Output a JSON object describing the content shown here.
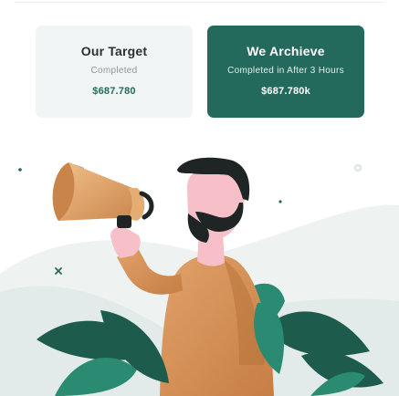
{
  "colors": {
    "accent": "#236a5c",
    "card_light": "#f2f5f5",
    "skin": "#f7bfc8",
    "shirt": "#d8935a",
    "hair": "#1f2425",
    "leaf_dark": "#1d5c4c",
    "leaf_mid": "#2b8a72"
  },
  "cards": {
    "target": {
      "title": "Our Target",
      "subtitle": "Completed",
      "amount": "$687.780"
    },
    "achieve": {
      "title": "We Archieve",
      "subtitle": "Completed in After 3 Hours",
      "amount": "$687.780k"
    }
  },
  "illustration": {
    "icon": "person-with-megaphone-illustration"
  }
}
